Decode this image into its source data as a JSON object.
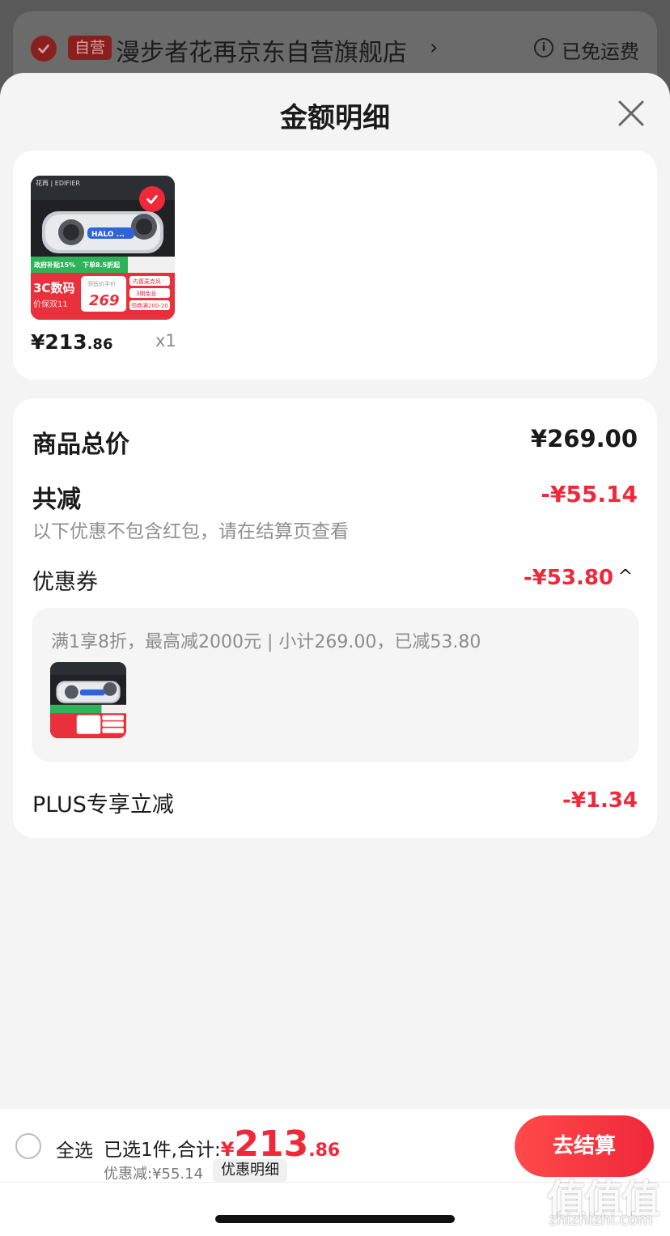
{
  "store": {
    "badge": "自营",
    "name": "漫步者花再京东自营旗舰店",
    "chevron": "›",
    "info_icon": "i",
    "shipping": "已免运费"
  },
  "sheet": {
    "title": "金额明细"
  },
  "product": {
    "price_int": "¥213",
    "price_dec": ".86",
    "qty": "x1",
    "image_text": {
      "brand": "花再 | EDIFIER",
      "speaker_text": "HALO ...",
      "gov_subsidy": "政府补贴15%",
      "discount": "下单8.5折起",
      "category": "3C数码",
      "promo": "价保双11",
      "price_label": "领低价手价",
      "price": "269",
      "tag1": "内置麦克风",
      "tag2": "3期免息",
      "tag3": "领券满200-20"
    }
  },
  "price_detail": {
    "total_label": "商品总价",
    "total_value": "¥269.00",
    "reduce_label": "共减",
    "reduce_value": "-¥55.14",
    "note": "以下优惠不包含红包，请在结算页查看",
    "coupon_label": "优惠券",
    "coupon_value": "-¥53.80",
    "coupon_toggle": "^",
    "coupon_desc": "满1享8折，最高减2000元 | 小计269.00，已减53.80",
    "plus_label": "PLUS专享立减",
    "plus_value": "-¥1.34"
  },
  "bottom": {
    "select_all": "全选",
    "summary_lead": "已选1件,合计:",
    "yen": "¥",
    "total_int": "213",
    "total_dec": ".86",
    "discount_text": "优惠减:¥55.14",
    "detail_btn": "优惠明细",
    "checkout": "去结算"
  },
  "watermark": {
    "glyphs": "值值值",
    "url": "zhizhizhi.com"
  },
  "colors": {
    "accent_red": "#f0283a",
    "sheet_bg": "#f4f4f4",
    "overlay": "#4a4a4a"
  }
}
